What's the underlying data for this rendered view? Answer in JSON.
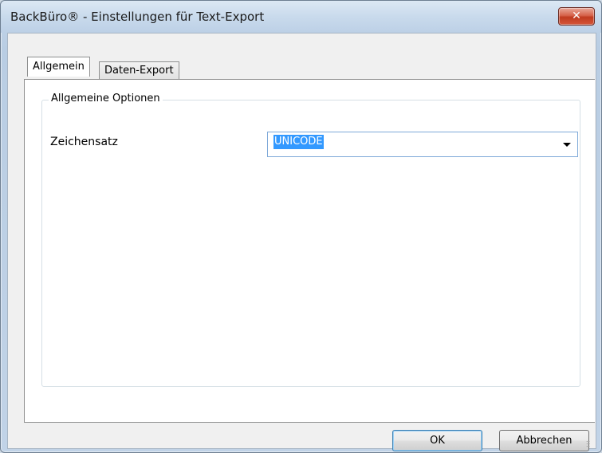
{
  "window": {
    "title": "BackBüro® - Einstellungen für Text-Export",
    "close_glyph": "✕"
  },
  "tabs": [
    {
      "label": "Allgemein",
      "active": true
    },
    {
      "label": "Daten-Export",
      "active": false
    }
  ],
  "general": {
    "group_title": "Allgemeine Optionen",
    "charset_label": "Zeichensatz",
    "charset_value": "UNICODE"
  },
  "buttons": {
    "ok": "OK",
    "cancel": "Abbrechen"
  },
  "colors": {
    "selection": "#3399ff",
    "close_button": "#c03a1f"
  }
}
